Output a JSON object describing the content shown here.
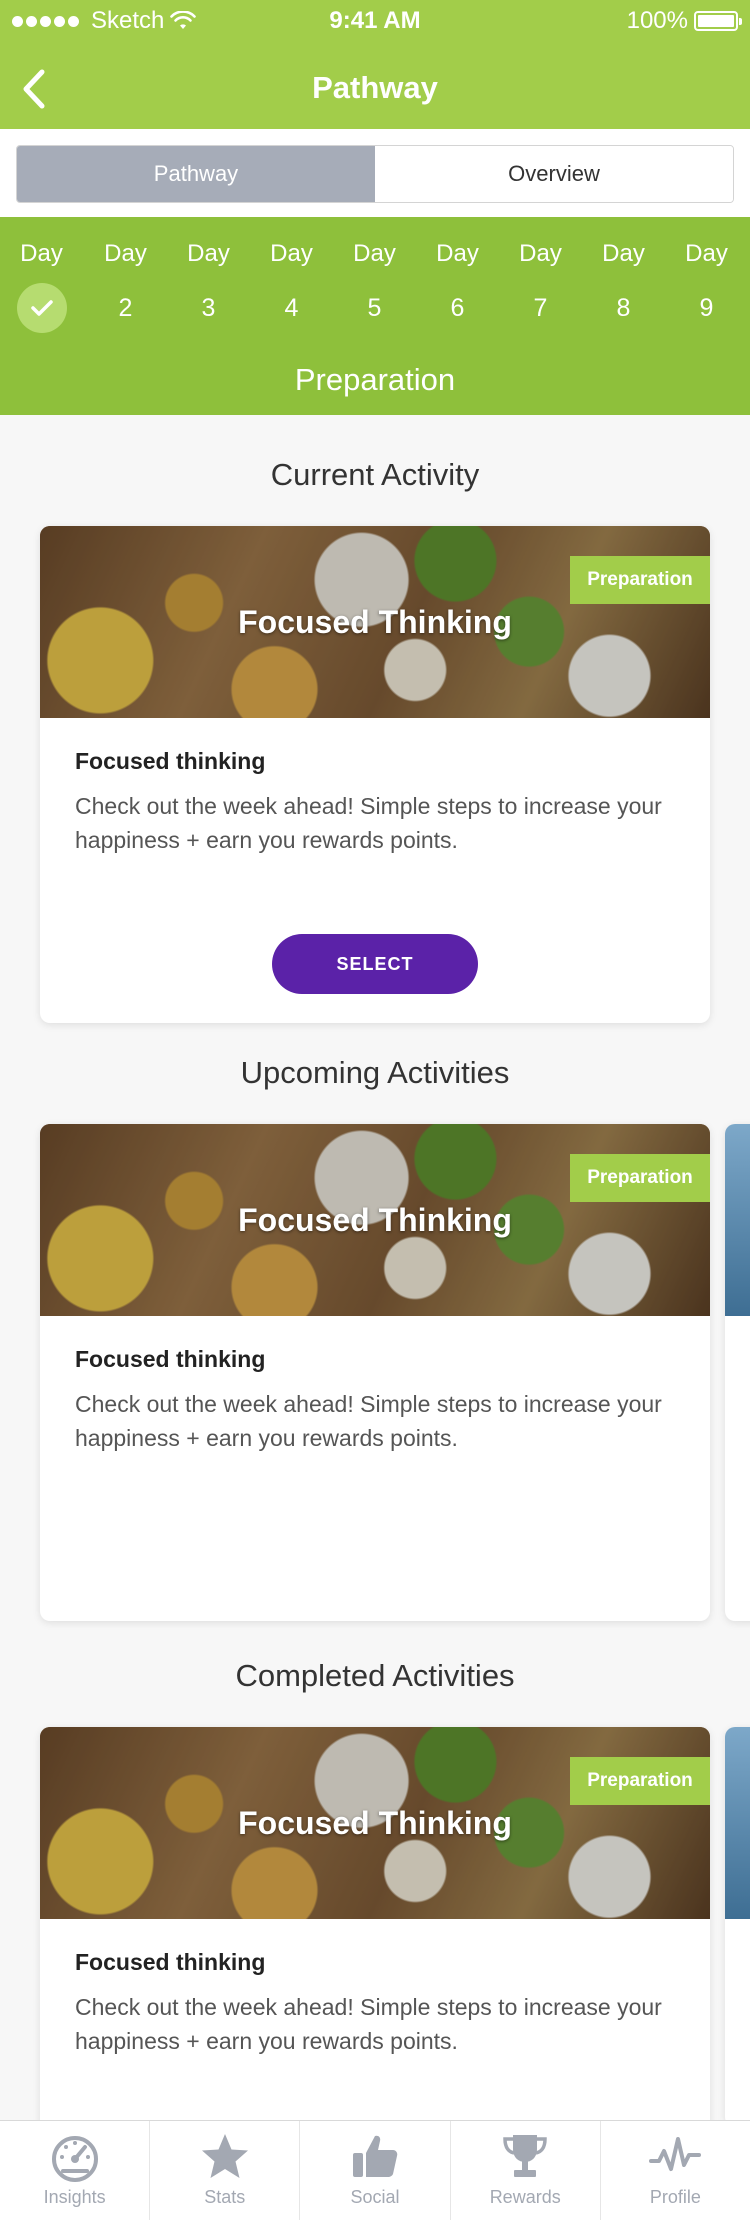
{
  "status_bar": {
    "carrier": "Sketch",
    "time": "9:41 AM",
    "battery": "100%"
  },
  "nav": {
    "title": "Pathway"
  },
  "segment": {
    "tabs": [
      {
        "label": "Pathway",
        "active": true
      },
      {
        "label": "Overview",
        "active": false
      }
    ]
  },
  "days": {
    "label": "Day",
    "items": [
      {
        "num": "",
        "done": true
      },
      {
        "num": "2",
        "done": false
      },
      {
        "num": "3",
        "done": false
      },
      {
        "num": "4",
        "done": false
      },
      {
        "num": "5",
        "done": false
      },
      {
        "num": "6",
        "done": false
      },
      {
        "num": "7",
        "done": false
      },
      {
        "num": "8",
        "done": false
      },
      {
        "num": "9",
        "done": false
      }
    ],
    "phase": "Preparation"
  },
  "sections": {
    "current": "Current Activity",
    "upcoming": "Upcoming Activities",
    "completed": "Completed Activities"
  },
  "card": {
    "image_title": "Focused Thinking",
    "badge": "Preparation",
    "heading": "Focused thinking",
    "description": "Check out the week ahead! Simple steps to increase your happiness + earn you rewards points.",
    "select_label": "SELECT"
  },
  "tabbar": {
    "items": [
      {
        "label": "Insights",
        "icon": "gauge-icon"
      },
      {
        "label": "Stats",
        "icon": "star-icon"
      },
      {
        "label": "Social",
        "icon": "thumbs-up-icon"
      },
      {
        "label": "Rewards",
        "icon": "trophy-icon"
      },
      {
        "label": "Profile",
        "icon": "pulse-icon"
      }
    ]
  },
  "colors": {
    "header_green": "#a2cd4a",
    "days_green": "#8ec03b",
    "select_purple": "#5b22a8",
    "tab_icon_gray": "#a3a8b2"
  }
}
